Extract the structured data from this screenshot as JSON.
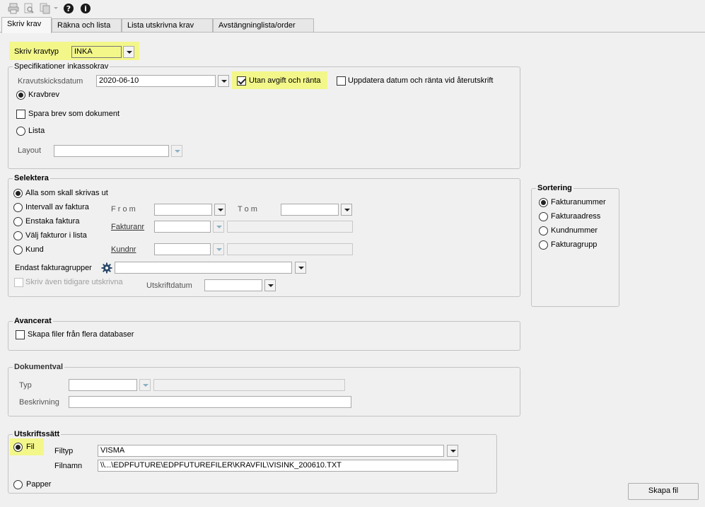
{
  "toolbar": {
    "icons": [
      "print-icon",
      "print-preview-icon",
      "copy-icon",
      "help-icon",
      "info-icon"
    ]
  },
  "tabs": [
    "Skriv krav",
    "Räkna och lista",
    "Lista utskrivna krav",
    "Avstängninglista/order"
  ],
  "kravtyp": {
    "label": "Skriv kravtyp",
    "value": "INKA"
  },
  "spec": {
    "title": "Specifikationer inkassokrav",
    "date_label": "Kravutskicksdatum",
    "date_value": "2020-06-10",
    "utan_avgift": "Utan avgift och ränta",
    "uppdatera": "Uppdatera datum och ränta vid återutskrift",
    "kravbrev": "Kravbrev",
    "spara_brev": "Spara brev som dokument",
    "lista": "Lista",
    "layout_label": "Layout",
    "layout_value": ""
  },
  "selektera": {
    "title": "Selektera",
    "options": [
      "Alla som skall skrivas ut",
      "Intervall av faktura",
      "Enstaka faktura",
      "Välj fakturor i lista",
      "Kund"
    ],
    "from_label": "F r o m",
    "tom_label": "T o m",
    "fakturanr_label": "Fakturanr",
    "kundnr_label": "Kundnr",
    "endast_label": "Endast fakturagrupper",
    "skriv_aven": "Skriv även tidigare utskrivna",
    "utskriftdatum_label": "Utskriftdatum"
  },
  "sortering": {
    "title": "Sortering",
    "options": [
      "Fakturanummer",
      "Fakturaadress",
      "Kundnummer",
      "Fakturagrupp"
    ]
  },
  "avancerat": {
    "title": "Avancerat",
    "skapa_filer": "Skapa filer från flera databaser"
  },
  "dokumentval": {
    "title": "Dokumentval",
    "typ_label": "Typ",
    "beskrivning_label": "Beskrivning"
  },
  "utskriftssatt": {
    "title": "Utskriftssätt",
    "fil": "Fil",
    "papper": "Papper",
    "filtyp_label": "Filtyp",
    "filtyp_value": "VISMA",
    "filnamn_label": "Filnamn",
    "filnamn_value": "\\\\...\\EDPFUTURE\\EDPFUTUREFILER\\KRAVFIL\\VISINK_200610.TXT"
  },
  "skapa_fil_button": "Skapa fil",
  "colors": {
    "highlight": "#f3f78a",
    "background": "#f0f0f0"
  }
}
